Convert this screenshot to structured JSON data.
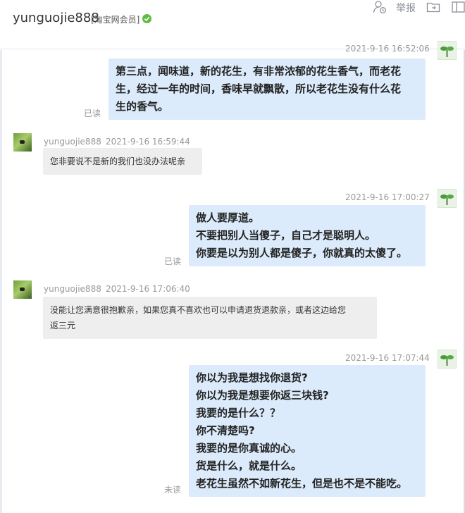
{
  "header": {
    "username": "yunguojie888",
    "member_badge": "[淘宝网会员]",
    "report_label": "举报"
  },
  "messages": [
    {
      "side": "right",
      "timestamp": "2021-9-16 16:52:06",
      "lines": [
        "第三点，闻味道，新的花生，有非常浓郁的花生香气，而老花",
        "生，经过一年的时间，香味早就飘散，所以老花生没有什么花",
        "生的香气。"
      ],
      "status": "已读"
    },
    {
      "side": "left",
      "nick": "yunguojie888",
      "timestamp": "2021-9-16 16:59:44",
      "lines": [
        "您非要说不是新的我们也没办法呢亲"
      ]
    },
    {
      "side": "right",
      "timestamp": "2021-9-16 17:00:27",
      "lines": [
        "做人要厚道。",
        "不要把别人当傻子，自己才是聪明人。",
        "你要是以为别人都是傻子，你就真的太傻了。"
      ],
      "status": "已读"
    },
    {
      "side": "left",
      "nick": "yunguojie888",
      "timestamp": "2021-9-16 17:06:40",
      "lines": [
        "没能让您满意很抱歉亲，如果您真不喜欢也可以申请退货退款亲，或者这边给您",
        "返三元"
      ]
    },
    {
      "side": "right",
      "timestamp": "2021-9-16 17:07:44",
      "lines": [
        "你以为我是想找你退货?",
        "你以为我是想要你返三块钱?",
        "我要的是什么？？",
        "你不清楚吗?",
        "我要的是你真诚的心。",
        "货是什么，就是什么。",
        "老花生虽然不如新花生，但是也不是不能吃。"
      ],
      "status": "未读"
    }
  ],
  "colors": {
    "bubble_right": "#dcebfb",
    "bubble_left": "#eeeeee",
    "verify_green": "#5fbb46"
  }
}
